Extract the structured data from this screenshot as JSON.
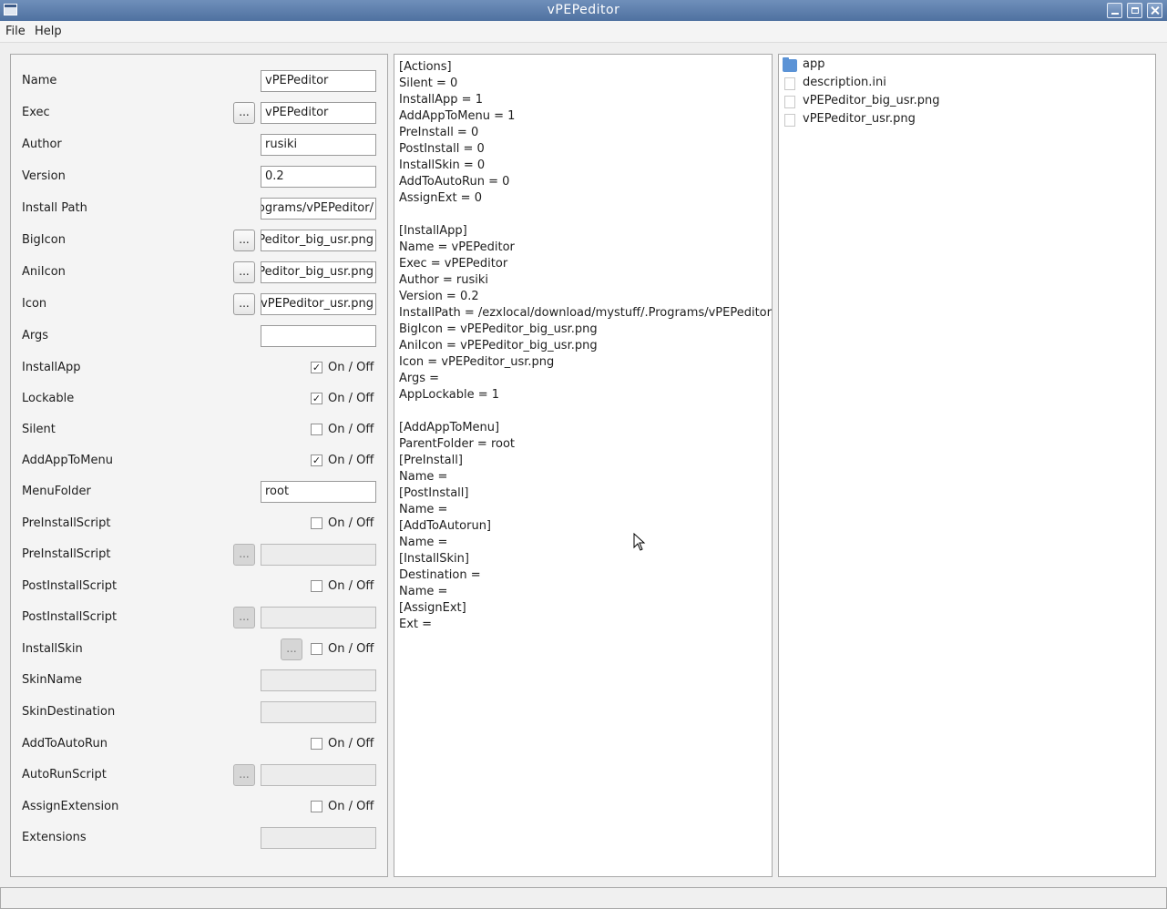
{
  "window": {
    "title": "vPEPeditor"
  },
  "menu": {
    "file": "File",
    "help": "Help"
  },
  "common": {
    "dots": "...",
    "toggle_label": "On / Off"
  },
  "form": {
    "name": {
      "label": "Name",
      "value": "vPEPeditor"
    },
    "exec": {
      "label": "Exec",
      "value": "vPEPeditor"
    },
    "author": {
      "label": "Author",
      "value": "rusiki"
    },
    "version": {
      "label": "Version",
      "value": "0.2"
    },
    "install_path": {
      "label": "Install Path",
      "value": "/ezxlocal/download/mystuff/.Programs/vPEPeditor"
    },
    "big_icon": {
      "label": "BigIcon",
      "value": "vPEPeditor_big_usr.png"
    },
    "ani_icon": {
      "label": "AniIcon",
      "value": "vPEPeditor_big_usr.png"
    },
    "icon": {
      "label": "Icon",
      "value": "vPEPeditor_usr.png"
    },
    "args": {
      "label": "Args",
      "value": ""
    },
    "install_app": {
      "label": "InstallApp",
      "checked": true
    },
    "lockable": {
      "label": "Lockable",
      "checked": true
    },
    "silent": {
      "label": "Silent",
      "checked": false
    },
    "add_app_to_menu": {
      "label": "AddAppToMenu",
      "checked": true
    },
    "menu_folder": {
      "label": "MenuFolder",
      "value": "root"
    },
    "pre_install_toggle": {
      "label": "PreInstallScript",
      "checked": false
    },
    "pre_install_script": {
      "label": "PreInstallScript",
      "value": ""
    },
    "post_install_toggle": {
      "label": "PostInstallScript",
      "checked": false
    },
    "post_install_script": {
      "label": "PostInstallScript",
      "value": ""
    },
    "install_skin": {
      "label": "InstallSkin",
      "checked": false
    },
    "skin_name": {
      "label": "SkinName",
      "value": ""
    },
    "skin_destination": {
      "label": "SkinDestination",
      "value": ""
    },
    "add_to_autorun": {
      "label": "AddToAutoRun",
      "checked": false
    },
    "autorun_script": {
      "label": "AutoRunScript",
      "value": ""
    },
    "assign_extension": {
      "label": "AssignExtension",
      "checked": false
    },
    "extensions": {
      "label": "Extensions",
      "value": ""
    }
  },
  "ini_lines": [
    "[Actions]",
    "Silent = 0",
    "InstallApp = 1",
    "AddAppToMenu = 1",
    "PreInstall = 0",
    "PostInstall = 0",
    "InstallSkin = 0",
    "AddToAutoRun = 0",
    "AssignExt = 0",
    "",
    "[InstallApp]",
    "Name = vPEPeditor",
    "Exec = vPEPeditor",
    "Author = rusiki",
    "Version = 0.2",
    "InstallPath = /ezxlocal/download/mystuff/.Programs/vPEPeditor",
    "BigIcon = vPEPeditor_big_usr.png",
    "AniIcon = vPEPeditor_big_usr.png",
    "Icon = vPEPeditor_usr.png",
    "Args =",
    "AppLockable = 1",
    "",
    "[AddAppToMenu]",
    "ParentFolder = root",
    "[PreInstall]",
    "Name =",
    "[PostInstall]",
    "Name =",
    "[AddToAutorun]",
    "Name =",
    "[InstallSkin]",
    "Destination =",
    "Name =",
    "[AssignExt]",
    "Ext ="
  ],
  "files": [
    {
      "name": "app",
      "icon": "folder-icon"
    },
    {
      "name": "description.ini",
      "icon": "file-icon"
    },
    {
      "name": "vPEPeditor_big_usr.png",
      "icon": "image-file-icon"
    },
    {
      "name": "vPEPeditor_usr.png",
      "icon": "image-file-icon"
    }
  ],
  "status": {
    "text": ""
  }
}
